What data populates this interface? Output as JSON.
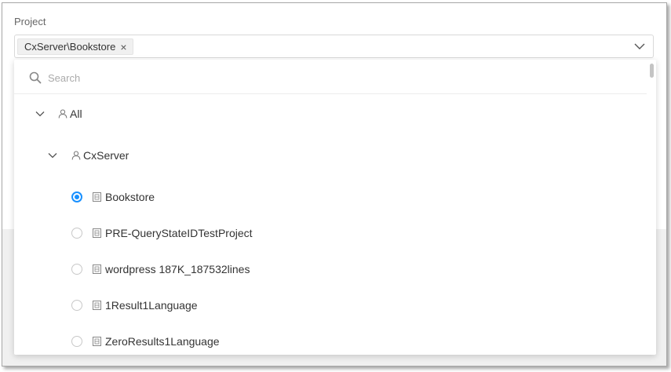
{
  "field": {
    "label": "Project"
  },
  "selected_tag": {
    "label": "CxServer\\Bookstore",
    "remove_glyph": "×"
  },
  "search": {
    "placeholder": "Search"
  },
  "tree": {
    "root": {
      "label": "All"
    },
    "group": {
      "label": "CxServer"
    },
    "projects": [
      {
        "label": "Bookstore",
        "selected": true
      },
      {
        "label": "PRE-QueryStateIDTestProject",
        "selected": false
      },
      {
        "label": "wordpress 187K_187532lines",
        "selected": false
      },
      {
        "label": "1Result1Language",
        "selected": false
      },
      {
        "label": "ZeroResults1Language",
        "selected": false
      }
    ]
  },
  "colors": {
    "accent": "#1890ff",
    "border": "#d9d9d9",
    "backdrop": "#f0f0f0"
  }
}
